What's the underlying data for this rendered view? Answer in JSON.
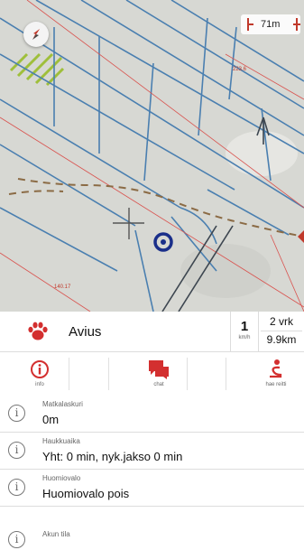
{
  "map": {
    "scale_label": "71m",
    "labels": [
      "223.6",
      "140.17"
    ]
  },
  "tracker": {
    "name": "Avius",
    "speed_value": "1",
    "speed_unit": "km/h",
    "time_value": "2 vrk",
    "distance_value": "9.9km"
  },
  "actions": [
    {
      "label": "info",
      "icon": "info-circle-icon",
      "color": "#d32f2f"
    },
    {
      "label": "chat",
      "icon": "chat-bubbles-icon",
      "color": "#d32f2f"
    },
    {
      "label": "hae reitti",
      "icon": "route-icon",
      "color": "#d32f2f"
    }
  ],
  "rows": [
    {
      "title": "Matkalaskuri",
      "value": "0m"
    },
    {
      "title": "Haukkuaika",
      "value": "Yht: 0 min, nyk.jakso 0 min"
    },
    {
      "title": "Huomiovalo",
      "value": "Huomiovalo pois"
    },
    {
      "title": "Akun tila",
      "value": ""
    }
  ],
  "colors": {
    "accent": "#d32f2f",
    "map_lines": "#4a7fb0",
    "target": "#1a2f8a"
  }
}
